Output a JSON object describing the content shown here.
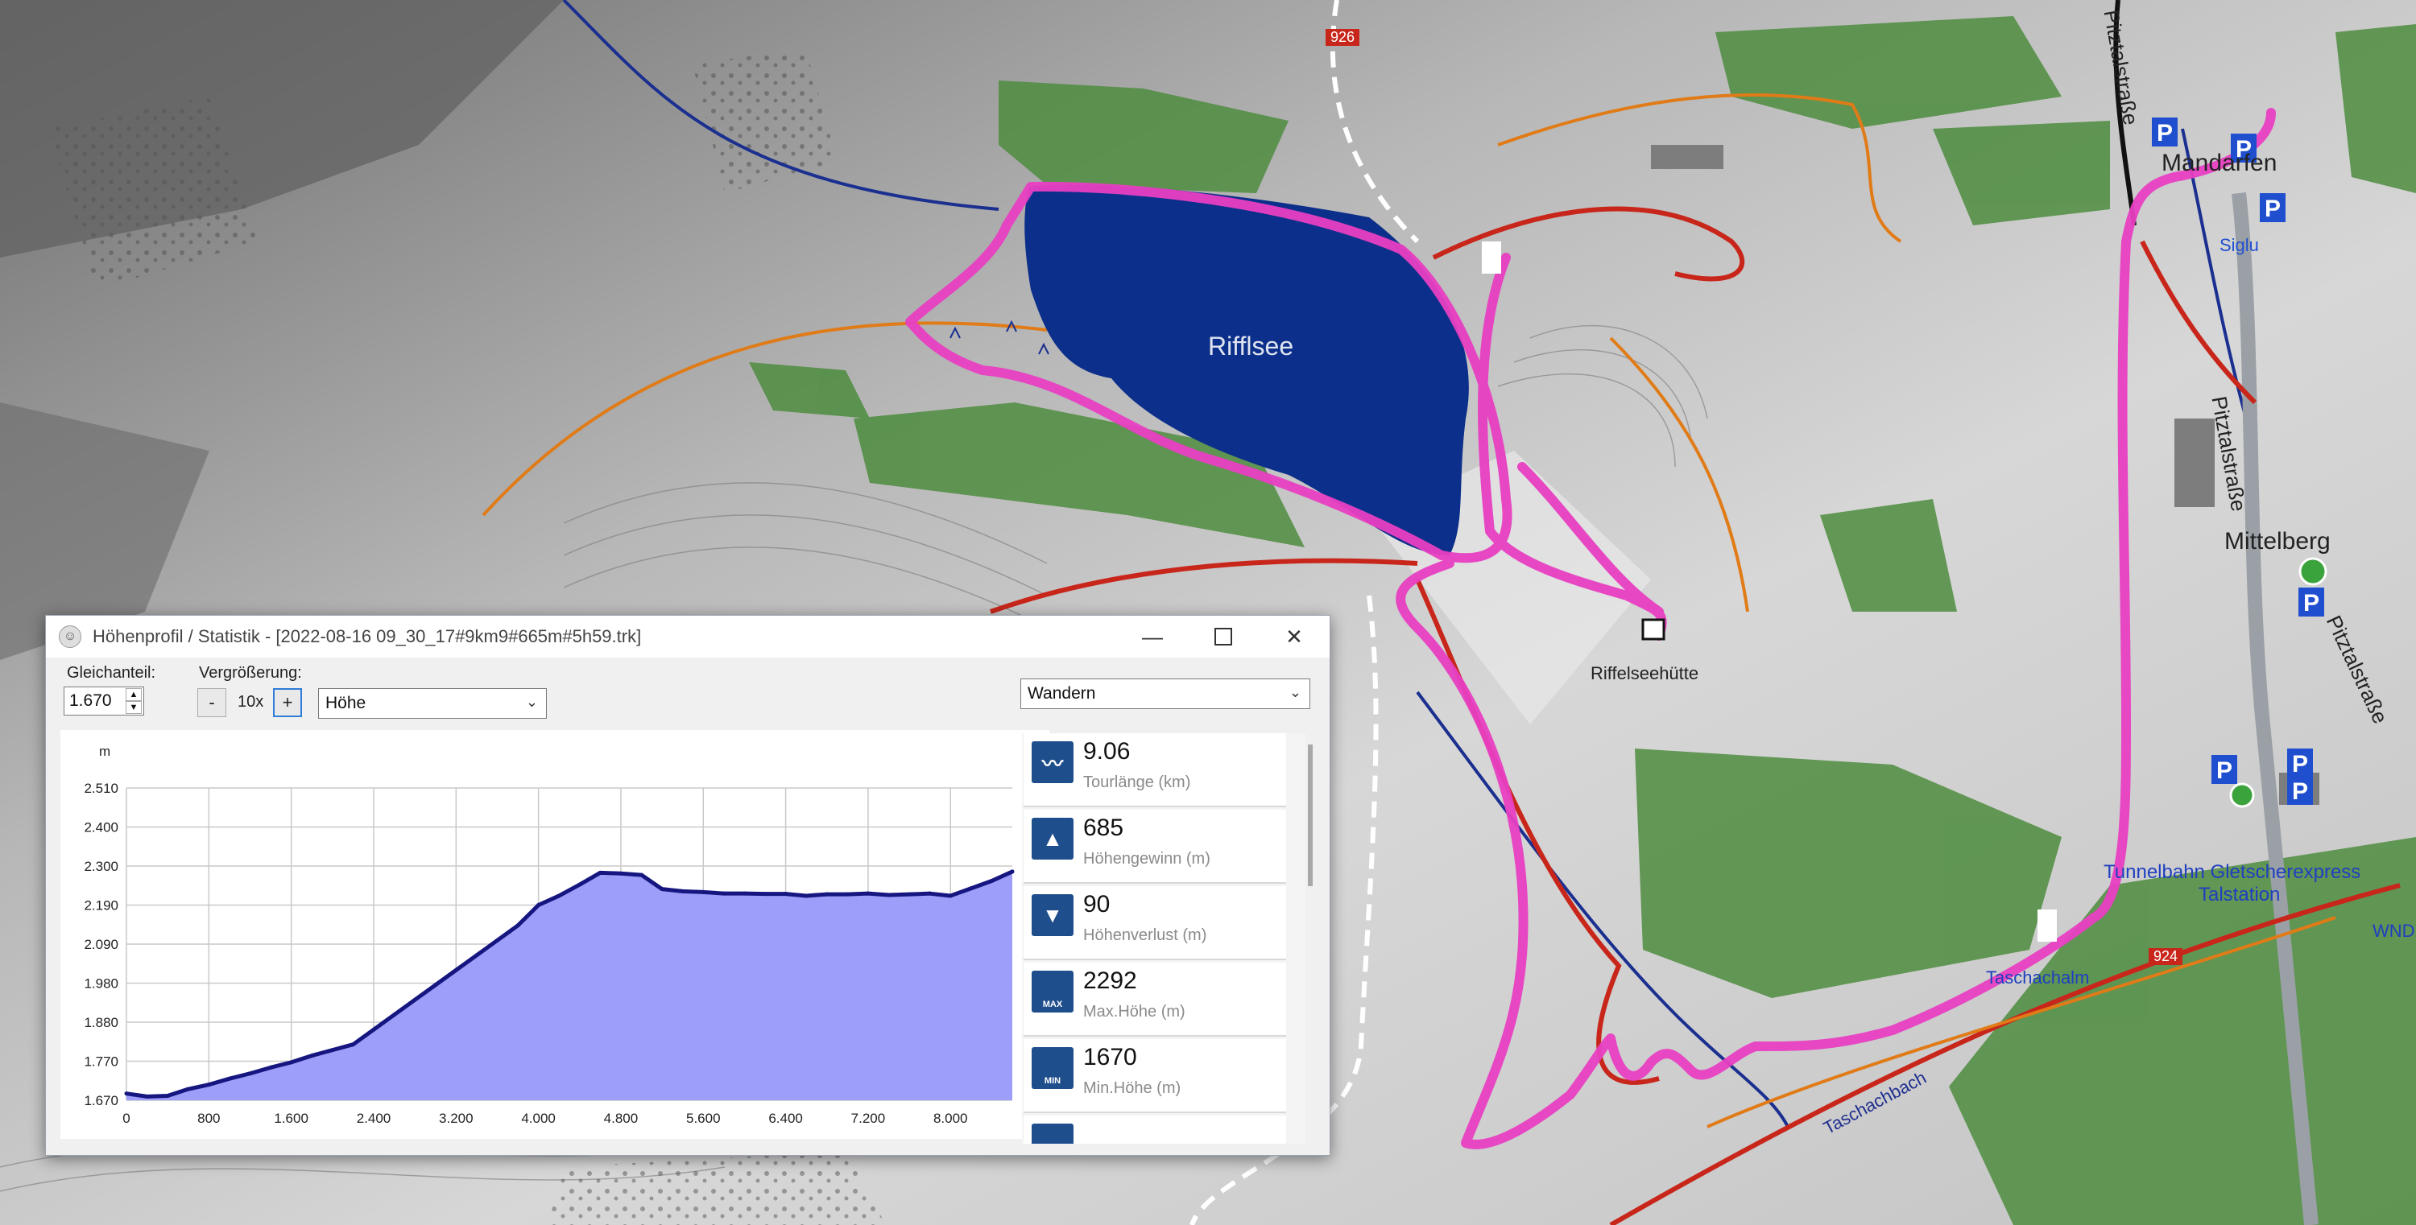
{
  "map": {
    "lake_label": "Rifflsee",
    "hut_label": "Riffelseehütte",
    "labels": {
      "mandarfen": "Mandarfen",
      "siglu": "Siglu",
      "mittelberg": "Mittelberg",
      "pitztalstrasse_1": "Pitztalstraße",
      "pitztalstrasse_2": "Pitztalstraße",
      "pitztalstrasse_3": "Pitztalstraße",
      "tunnelbahn": "Tunnelbahn Gletscherexpress",
      "talstation": "Talstation",
      "taschachalm": "Taschachalm",
      "taschachbach": "Taschachbach",
      "trail_924": "924",
      "trail_top": "926",
      "wnd": "WND"
    },
    "colors": {
      "track": "#e83fc2",
      "lake": "#0b2f8a",
      "forest": "#4d8c3e",
      "trail_red": "#c8261a",
      "trail_orange": "#e07b17"
    }
  },
  "window": {
    "title": "Höhenprofil / Statistik - [2022-08-16 09_30_17#9km9#665m#5h59.trk]",
    "controls": {
      "gleichanteil_label": "Gleichanteil:",
      "gleichanteil_value": "1.670",
      "vergroesserung_label": "Vergrößerung:",
      "minus_label": "-",
      "zoom_value": "10x",
      "plus_label": "+",
      "mode_select": "Höhe",
      "activity_select": "Wandern"
    }
  },
  "chart_data": {
    "type": "area",
    "ylabel": "m",
    "xlabel": "m",
    "xlim": [
      0,
      8600
    ],
    "ylim": [
      1670,
      2510
    ],
    "x_ticks": [
      "0",
      "800",
      "1.600",
      "2.400",
      "3.200",
      "4.000",
      "4.800",
      "5.600",
      "6.400",
      "7.200",
      "8.000"
    ],
    "y_ticks": [
      "2.510",
      "2.400",
      "2.300",
      "2.190",
      "2.090",
      "1.980",
      "1.880",
      "1.770",
      "1.670"
    ],
    "grid": true,
    "fill_color": "#9d9dfa",
    "line_color": "#161680",
    "x": [
      0,
      200,
      400,
      600,
      800,
      1000,
      1200,
      1400,
      1600,
      1800,
      2000,
      2200,
      2400,
      2600,
      2800,
      3000,
      3200,
      3400,
      3600,
      3800,
      4000,
      4200,
      4400,
      4600,
      4800,
      5000,
      5200,
      5400,
      5600,
      5800,
      6000,
      6200,
      6400,
      6600,
      6800,
      7000,
      7200,
      7400,
      7600,
      7800,
      8000,
      8200,
      8400,
      8600
    ],
    "y": [
      1688,
      1680,
      1682,
      1700,
      1712,
      1728,
      1742,
      1758,
      1772,
      1790,
      1805,
      1820,
      1860,
      1900,
      1940,
      1980,
      2020,
      2060,
      2100,
      2140,
      2195,
      2220,
      2250,
      2282,
      2280,
      2276,
      2238,
      2232,
      2230,
      2226,
      2226,
      2225,
      2225,
      2220,
      2224,
      2224,
      2226,
      2222,
      2224,
      2226,
      2220,
      2240,
      2260,
      2285
    ]
  },
  "stats": [
    {
      "value": "9.06",
      "name": "Tourlänge (km)",
      "icon": "tour-length-icon"
    },
    {
      "value": "685",
      "name": "Höhengewinn (m)",
      "icon": "elevation-gain-icon"
    },
    {
      "value": "90",
      "name": "Höhenverlust (m)",
      "icon": "elevation-loss-icon"
    },
    {
      "value": "2292",
      "name": "Max.Höhe (m)",
      "icon": "max-height-icon",
      "badge": "MAX"
    },
    {
      "value": "1670",
      "name": "Min.Höhe (m)",
      "icon": "min-height-icon",
      "badge": "MIN"
    }
  ]
}
